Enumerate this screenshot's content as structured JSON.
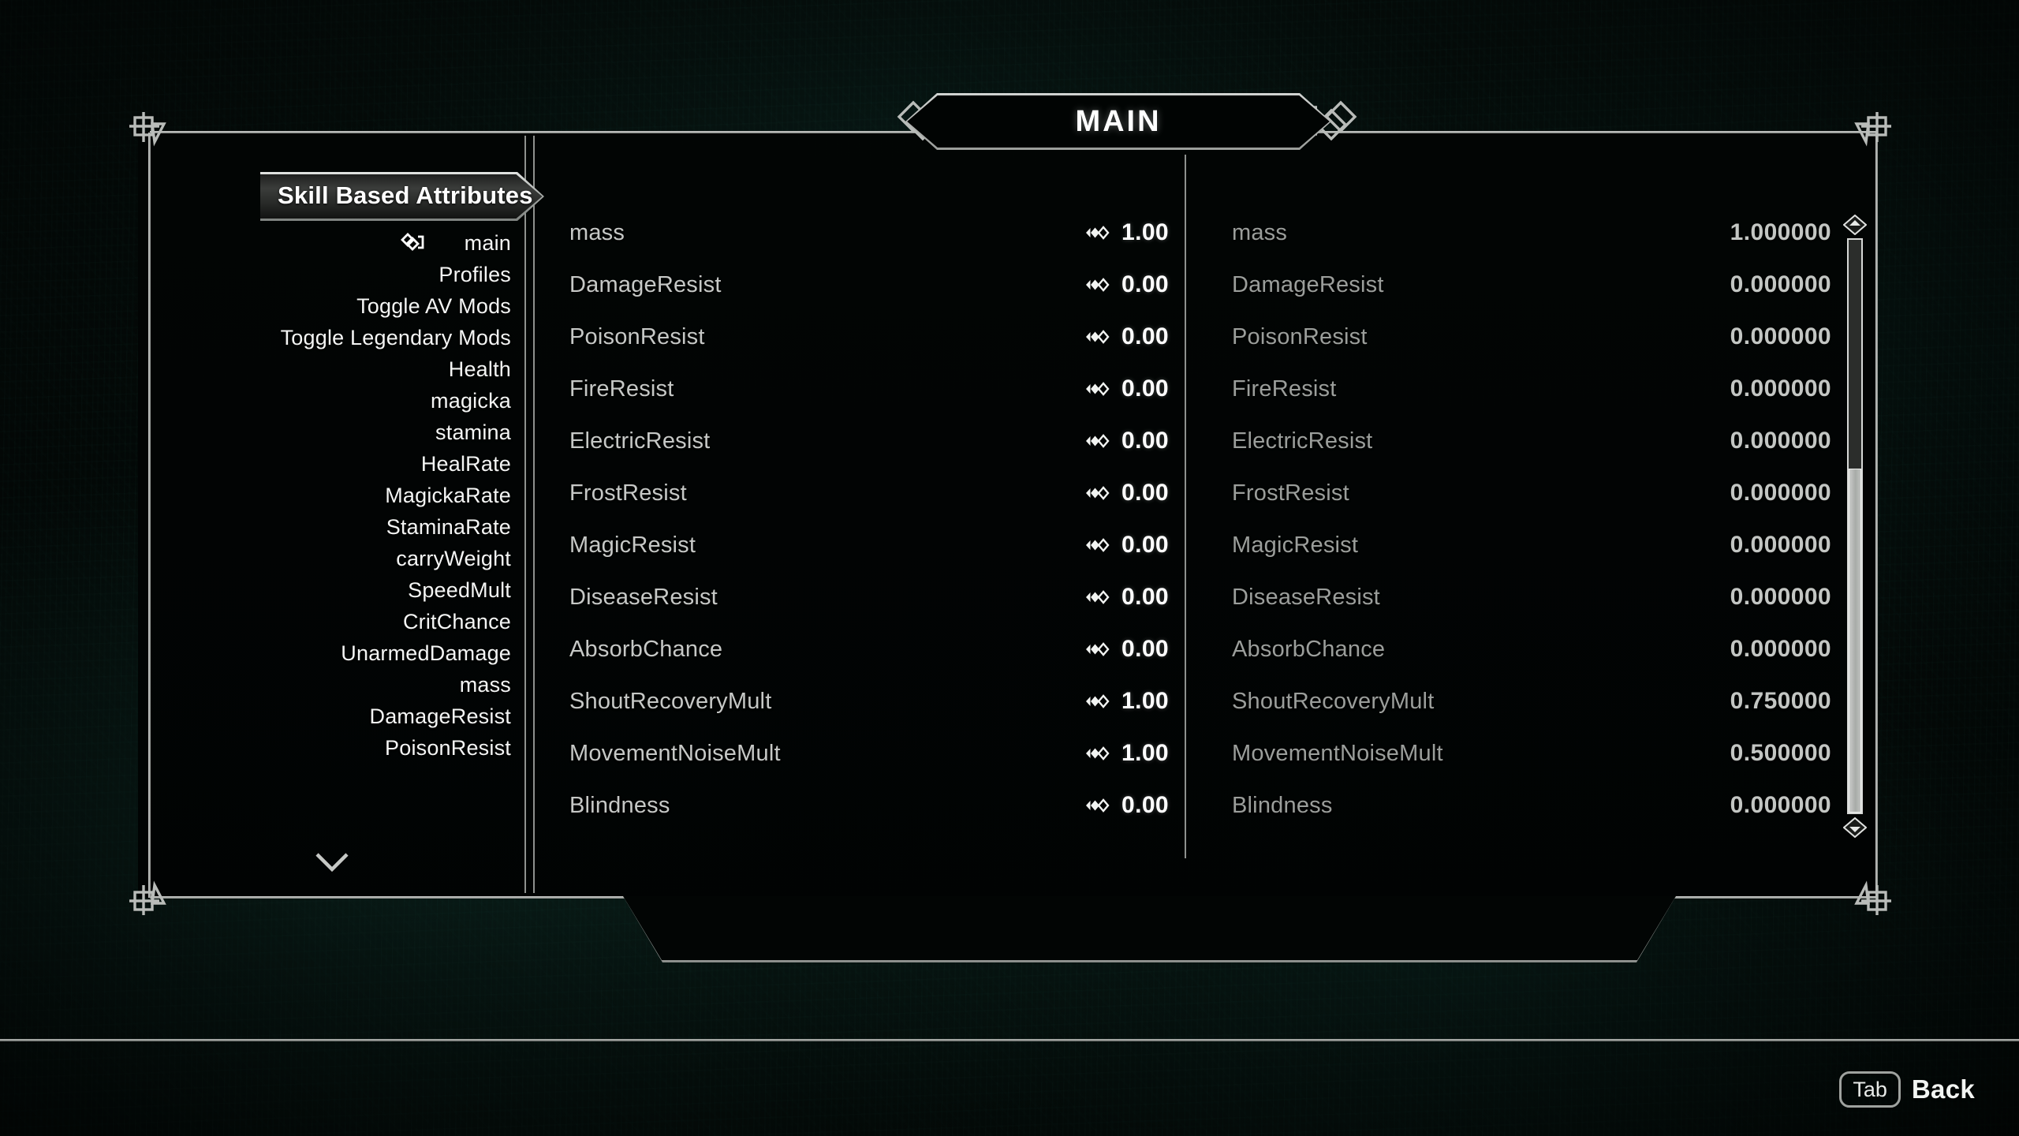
{
  "window": {
    "title": "MAIN",
    "selected_tab": "Skill Based Attributes"
  },
  "sidebar": {
    "selected_marker_icon": "knot-marker-icon",
    "more_icon": "chevron-down-icon",
    "items": [
      {
        "label": "main",
        "selected": true
      },
      {
        "label": "Profiles",
        "selected": false
      },
      {
        "label": "Toggle AV Mods",
        "selected": false
      },
      {
        "label": "Toggle Legendary Mods",
        "selected": false
      },
      {
        "label": "Health",
        "selected": false
      },
      {
        "label": "magicka",
        "selected": false
      },
      {
        "label": "stamina",
        "selected": false
      },
      {
        "label": "HealRate",
        "selected": false
      },
      {
        "label": "MagickaRate",
        "selected": false
      },
      {
        "label": "StaminaRate",
        "selected": false
      },
      {
        "label": "carryWeight",
        "selected": false
      },
      {
        "label": "SpeedMult",
        "selected": false
      },
      {
        "label": "CritChance",
        "selected": false
      },
      {
        "label": "UnarmedDamage",
        "selected": false
      },
      {
        "label": "mass",
        "selected": false
      },
      {
        "label": "DamageResist",
        "selected": false
      },
      {
        "label": "PoisonResist",
        "selected": false
      }
    ]
  },
  "middle_column": {
    "stepper_icon": "diamond-stepper-icon",
    "rows": [
      {
        "label": "mass",
        "value": "1.00"
      },
      {
        "label": "DamageResist",
        "value": "0.00"
      },
      {
        "label": "PoisonResist",
        "value": "0.00"
      },
      {
        "label": "FireResist",
        "value": "0.00"
      },
      {
        "label": "ElectricResist",
        "value": "0.00"
      },
      {
        "label": "FrostResist",
        "value": "0.00"
      },
      {
        "label": "MagicResist",
        "value": "0.00"
      },
      {
        "label": "DiseaseResist",
        "value": "0.00"
      },
      {
        "label": "AbsorbChance",
        "value": "0.00"
      },
      {
        "label": "ShoutRecoveryMult",
        "value": "1.00"
      },
      {
        "label": "MovementNoiseMult",
        "value": "1.00"
      },
      {
        "label": "Blindness",
        "value": "0.00"
      }
    ]
  },
  "right_column": {
    "rows": [
      {
        "label": "mass",
        "value": "1.000000"
      },
      {
        "label": "DamageResist",
        "value": "0.000000"
      },
      {
        "label": "PoisonResist",
        "value": "0.000000"
      },
      {
        "label": "FireResist",
        "value": "0.000000"
      },
      {
        "label": "ElectricResist",
        "value": "0.000000"
      },
      {
        "label": "FrostResist",
        "value": "0.000000"
      },
      {
        "label": "MagicResist",
        "value": "0.000000"
      },
      {
        "label": "DiseaseResist",
        "value": "0.000000"
      },
      {
        "label": "AbsorbChance",
        "value": "0.000000"
      },
      {
        "label": "ShoutRecoveryMult",
        "value": "0.750000"
      },
      {
        "label": "MovementNoiseMult",
        "value": "0.500000"
      },
      {
        "label": "Blindness",
        "value": "0.000000"
      }
    ]
  },
  "scrollbar": {
    "up_icon": "scroll-up-diamond-icon",
    "down_icon": "scroll-down-diamond-icon",
    "thumb_top_percent": 40,
    "thumb_height_percent": 60
  },
  "hud": {
    "key": "Tab",
    "action": "Back"
  },
  "colors": {
    "frame": "#c9cbc9",
    "value_bright": "#ffffff",
    "value_dim": "#c3c6c3",
    "label_dim": "#9b9e9b",
    "panel_bg": "#020504",
    "background": "#06100d"
  }
}
